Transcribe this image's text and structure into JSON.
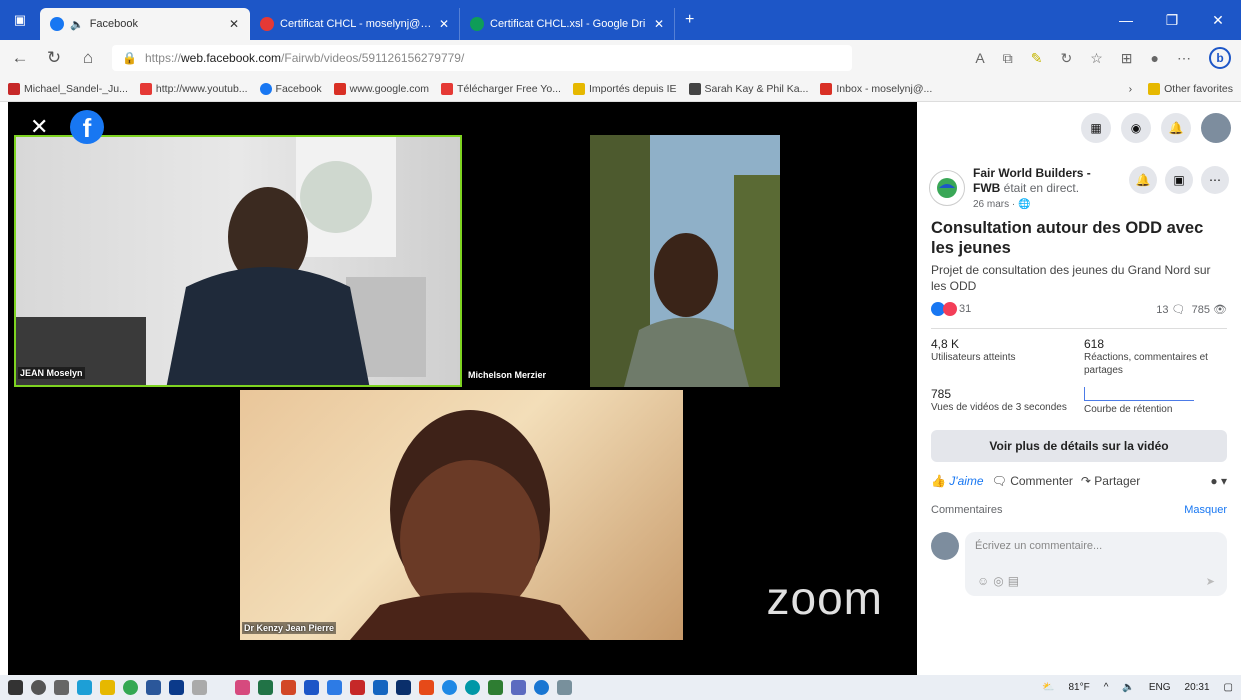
{
  "browser": {
    "tabs": [
      {
        "title": "Facebook",
        "active": true
      },
      {
        "title": "Certificat CHCL - moselynj@gm",
        "active": false
      },
      {
        "title": "Certificat CHCL.xsl - Google Dri",
        "active": false
      }
    ],
    "url_prefix": "https://",
    "url_domain": "web.facebook.com",
    "url_path": "/Fairwb/videos/591126156279779/",
    "bookmarks": [
      {
        "label": "Michael_Sandel-_Ju...",
        "color": "#c62828"
      },
      {
        "label": "http://www.youtub...",
        "color": "#e53935"
      },
      {
        "label": "Facebook",
        "color": "#1877f2"
      },
      {
        "label": "www.google.com",
        "color": "#d93025"
      },
      {
        "label": "Télécharger Free Yo...",
        "color": "#e53935"
      },
      {
        "label": "Importés depuis IE",
        "color": "#e6b800"
      },
      {
        "label": "Sarah Kay & Phil Ka...",
        "color": "#444444"
      },
      {
        "label": "Inbox - moselynj@...",
        "color": "#d93025"
      }
    ],
    "other_favorites": "Other favorites"
  },
  "video": {
    "participants": [
      "JEAN Moselyn",
      "Michelson Merzier",
      "Dr Kenzy Jean Pierre"
    ],
    "zoom_logo": "zoom"
  },
  "panel": {
    "page_name": "Fair World Builders - FWB",
    "live_text": "était en direct.",
    "date": "26 mars · ",
    "video_title": "Consultation autour des ODD avec les jeunes",
    "description": "Projet de consultation des jeunes du Grand Nord sur les ODD",
    "reaction_count": "31",
    "comments_count": "13",
    "views_count": "785",
    "stats": [
      {
        "value": "4,8 K",
        "label": "Utilisateurs atteints"
      },
      {
        "value": "618",
        "label": "Réactions, commentaires et partages"
      },
      {
        "value": "785",
        "label": "Vues de vidéos de 3 secondes"
      },
      {
        "value": "",
        "label": "Courbe de rétention"
      }
    ],
    "more_button": "Voir plus de détails sur la vidéo",
    "like_label": "J'aime",
    "comment_label": "Commenter",
    "share_label": "Partager",
    "comments_header": "Commentaires",
    "hide_label": "Masquer",
    "comment_placeholder": "Écrivez un commentaire..."
  },
  "taskbar": {
    "weather": "81°F",
    "lang": "ENG",
    "time": "20:31"
  }
}
